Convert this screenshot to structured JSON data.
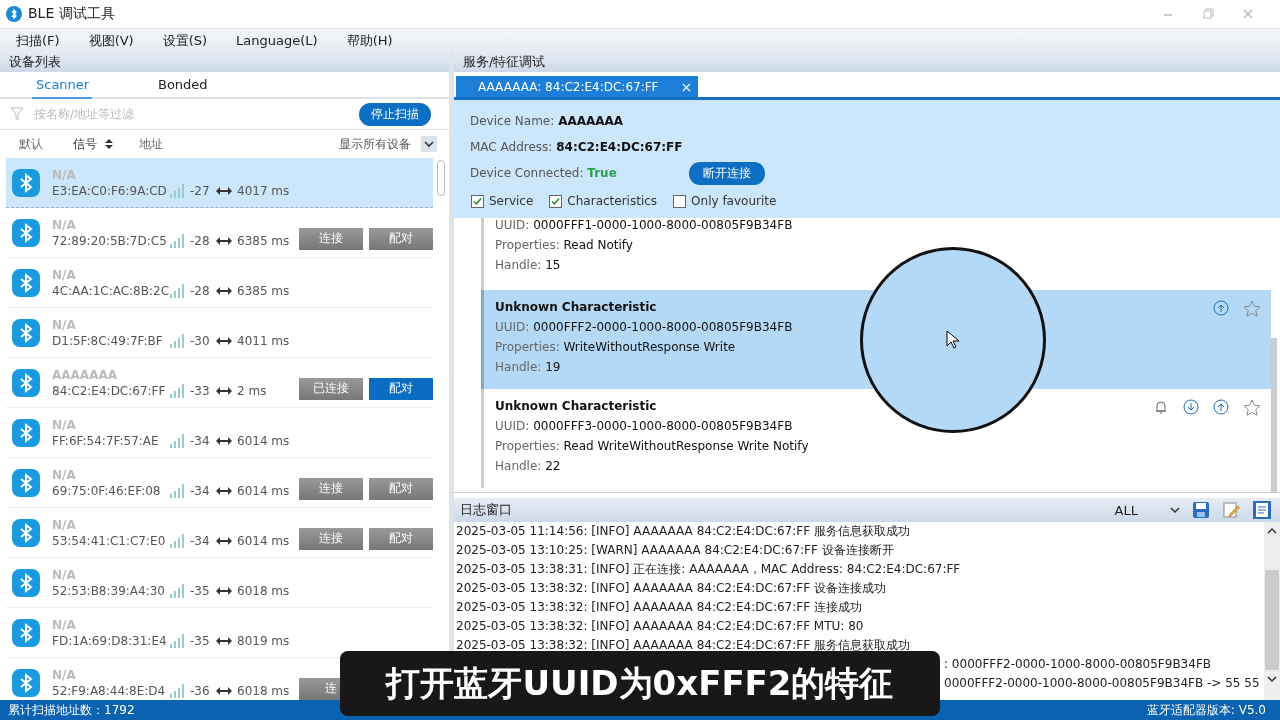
{
  "window": {
    "title": "BLE 调试工具"
  },
  "menu": [
    "扫描(F)",
    "视图(V)",
    "设置(S)",
    "Language(L)",
    "帮助(H)"
  ],
  "devices_panel": {
    "title": "设备列表",
    "tabs": [
      {
        "label": "Scanner",
        "selected": true
      },
      {
        "label": "Bonded",
        "selected": false
      }
    ],
    "filter": {
      "placeholder": "按名称/地址等过滤"
    },
    "stop_button": "停止扫描",
    "columns": [
      {
        "label": "默认",
        "sort": false
      },
      {
        "label": "信号",
        "sort": true
      },
      {
        "label": "地址",
        "sort": false
      }
    ],
    "show_filter": "显示所有设备",
    "devices": [
      {
        "name": "N/A",
        "mac": "E3:EA:C0:F6:9A:CD",
        "rssi": "-27",
        "interval": "4017 ms",
        "selected": true
      },
      {
        "name": "N/A",
        "mac": "72:89:20:5B:7D:C5",
        "rssi": "-28",
        "interval": "6385 ms",
        "selected": false,
        "buttons": [
          {
            "label": "连接",
            "active": false
          },
          {
            "label": "配对",
            "active": false
          }
        ]
      },
      {
        "name": "N/A",
        "mac": "4C:AA:1C:AC:8B:2C",
        "rssi": "-28",
        "interval": "6385 ms",
        "selected": false
      },
      {
        "name": "N/A",
        "mac": "D1:5F:8C:49:7F:BF",
        "rssi": "-30",
        "interval": "4011 ms",
        "selected": false
      },
      {
        "name": "AAAAAAA",
        "mac": "84:C2:E4:DC:67:FF",
        "rssi": "-33",
        "interval": "2 ms",
        "selected": false,
        "buttons": [
          {
            "label": "已连接",
            "active": false
          },
          {
            "label": "配对",
            "active": true
          }
        ]
      },
      {
        "name": "N/A",
        "mac": "FF:6F:54:7F:57:AE",
        "rssi": "-34",
        "interval": "6014 ms",
        "selected": false
      },
      {
        "name": "N/A",
        "mac": "69:75:0F:46:EF:08",
        "rssi": "-34",
        "interval": "6014 ms",
        "selected": false,
        "buttons": [
          {
            "label": "连接",
            "active": false
          },
          {
            "label": "配对",
            "active": false
          }
        ]
      },
      {
        "name": "N/A",
        "mac": "53:54:41:C1:C7:E0",
        "rssi": "-34",
        "interval": "6014 ms",
        "selected": false,
        "buttons": [
          {
            "label": "连接",
            "active": false
          },
          {
            "label": "配对",
            "active": false
          }
        ]
      },
      {
        "name": "N/A",
        "mac": "52:53:B8:39:A4:30",
        "rssi": "-35",
        "interval": "6018 ms",
        "selected": false
      },
      {
        "name": "N/A",
        "mac": "FD:1A:69:D8:31:E4",
        "rssi": "-35",
        "interval": "8019 ms",
        "selected": false
      },
      {
        "name": "N/A",
        "mac": "52:F9:A8:44:8E:D4",
        "rssi": "-36",
        "interval": "6018 ms",
        "selected": false,
        "buttons": [
          {
            "label": "连"
          }
        ]
      }
    ]
  },
  "service_panel": {
    "title": "服务/特征调试",
    "tab": {
      "label": "AAAAAAA: 84:C2:E4:DC:67:FF",
      "close": "×"
    },
    "info": [
      {
        "label": "Device Name: ",
        "value": "AAAAAAA",
        "kind": "plain"
      },
      {
        "label": "MAC Address: ",
        "value": "84:C2:E4:DC:67:FF",
        "kind": "plain"
      },
      {
        "label": "Device Connected: ",
        "value": "True",
        "kind": "status"
      }
    ],
    "disconnect_button": "断开连接",
    "options": [
      {
        "label": "Service",
        "checked": true
      },
      {
        "label": "Characteristics",
        "checked": true
      },
      {
        "label": "Only favourite",
        "checked": false
      }
    ],
    "characteristics": [
      {
        "fields": [
          {
            "label": "UUID: ",
            "value": "0000FFF1-0000-1000-8000-00805F9B34FB"
          },
          {
            "label": "Properties: ",
            "value": "Read Notify"
          },
          {
            "label": "Handle: ",
            "value": "15"
          }
        ],
        "selected": false
      },
      {
        "title": "Unknown Characteristic",
        "fields": [
          {
            "label": "UUID: ",
            "value": "0000FFF2-0000-1000-8000-00805F9B34FB"
          },
          {
            "label": "Properties: ",
            "value": "WriteWithoutResponse Write"
          },
          {
            "label": "Handle: ",
            "value": "19"
          }
        ],
        "selected": true,
        "notify": false,
        "read": false,
        "write": true,
        "favourite": true
      },
      {
        "title": "Unknown Characteristic",
        "fields": [
          {
            "label": "UUID: ",
            "value": "0000FFF3-0000-1000-8000-00805F9B34FB"
          },
          {
            "label": "Properties: ",
            "value": "Read WriteWithoutResponse Write Notify"
          },
          {
            "label": "Handle: ",
            "value": "22"
          }
        ],
        "selected": false,
        "notify": true,
        "read": true,
        "write": true,
        "favourite": true
      }
    ]
  },
  "log": {
    "title": "日志窗口",
    "level": "ALL",
    "lines": [
      {
        "text": "2025-03-05 11:14:56:  [INFO] AAAAAAA 84:C2:E4:DC:67:FF 服务信息获取成功",
        "kind": "full"
      },
      {
        "text": "2025-03-05 13:10:25:  [WARN] AAAAAAA 84:C2:E4:DC:67:FF 设备连接断开",
        "kind": "full"
      },
      {
        "text": "2025-03-05 13:38:31:  [INFO] 正在连接: AAAAAAA，MAC Address: 84:C2:E4:DC:67:FF",
        "kind": "full"
      },
      {
        "text": "2025-03-05 13:38:32:  [INFO] AAAAAAA 84:C2:E4:DC:67:FF 设备连接成功",
        "kind": "full"
      },
      {
        "text": "2025-03-05 13:38:32:  [INFO] AAAAAAA 84:C2:E4:DC:67:FF 连接成功",
        "kind": "full"
      },
      {
        "text": "2025-03-05 13:38:32:  [INFO] AAAAAAA 84:C2:E4:DC:67:FF MTU: 80",
        "kind": "full"
      },
      {
        "text": "2025-03-05 13:38:32:  [INFO] AAAAAAA 84:C2:E4:DC:67:FF 服务信息获取成功",
        "kind": "full"
      },
      {
        "text": ": 0000FFF2-0000-1000-8000-00805F9B34FB",
        "kind": "partial"
      },
      {
        "text": "0000FFF2-0000-1000-8000-00805F9B34FB -> 55 55",
        "kind": "partial"
      }
    ]
  },
  "status_bar": {
    "scan_count": "累计扫描地址数：1792",
    "version": "蓝牙适配器版本: V5.0"
  },
  "caption": "打开蓝牙UUID为0xFFF2的特征"
}
